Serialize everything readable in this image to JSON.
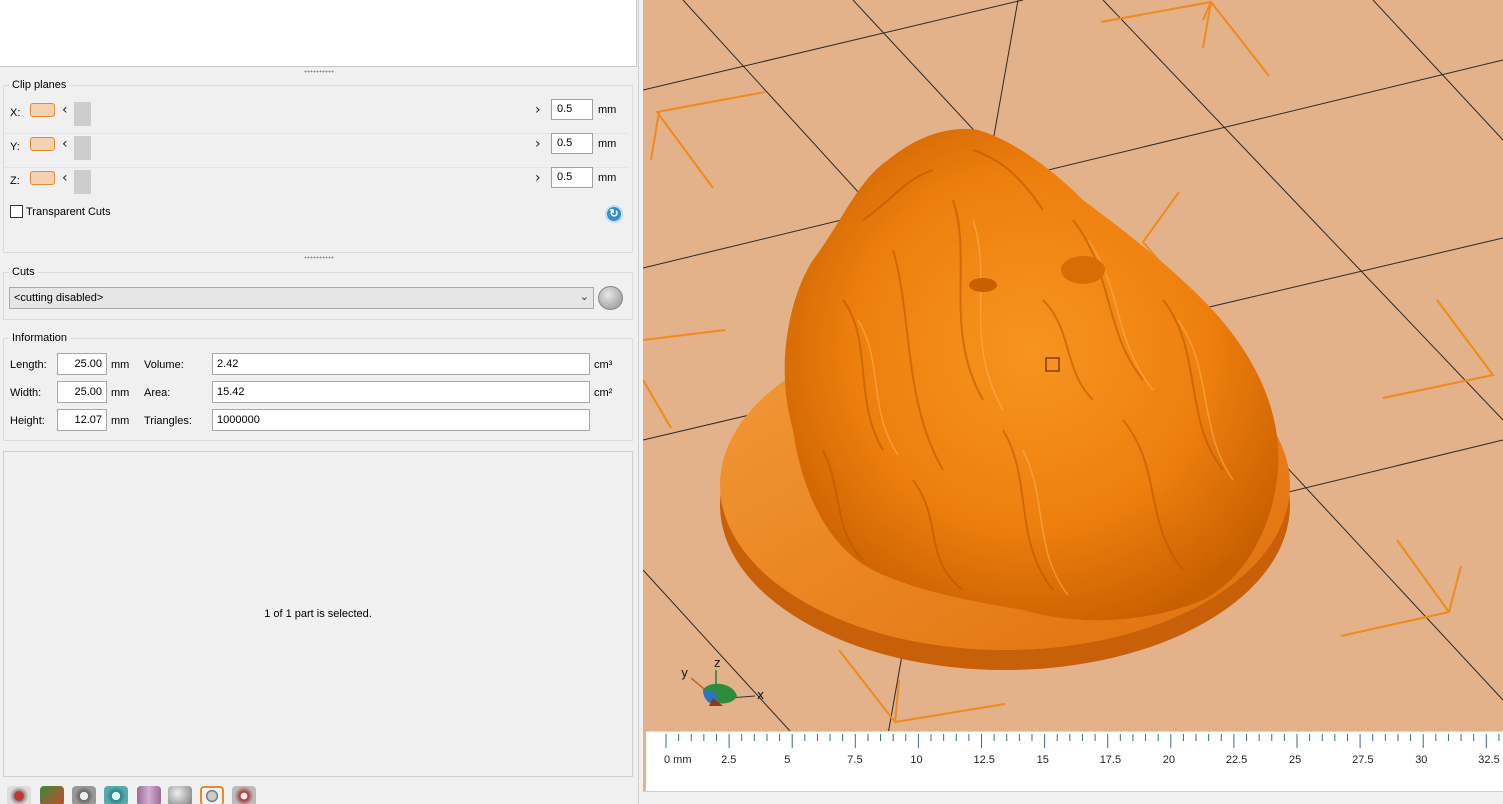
{
  "clip_planes": {
    "title": "Clip planes",
    "rows": [
      {
        "axis": "X:",
        "value": "0.5",
        "unit": "mm"
      },
      {
        "axis": "Y:",
        "value": "0.5",
        "unit": "mm"
      },
      {
        "axis": "Z:",
        "value": "0.5",
        "unit": "mm"
      }
    ],
    "transparent_cuts_label": "Transparent Cuts",
    "transparent_cuts_checked": false
  },
  "cuts": {
    "title": "Cuts",
    "selected": "<cutting disabled>"
  },
  "information": {
    "title": "Information",
    "length_label": "Length:",
    "length_value": "25.00",
    "width_label": "Width:",
    "width_value": "25.00",
    "height_label": "Height:",
    "height_value": "12.07",
    "dim_unit": "mm",
    "volume_label": "Volume:",
    "volume_value": "2.42",
    "volume_unit": "cm³",
    "area_label": "Area:",
    "area_value": "15.42",
    "area_unit": "cm²",
    "triangles_label": "Triangles:",
    "triangles_value": "1000000"
  },
  "status": {
    "selection_text": "1 of 1 part is selected."
  },
  "viewport": {
    "ruler_labels": [
      "0 mm",
      "2.5",
      "5",
      "7.5",
      "10",
      "12.5",
      "15",
      "17.5",
      "20",
      "22.5",
      "25",
      "27.5",
      "30",
      "32.5"
    ],
    "gizmo": {
      "x": "x",
      "y": "y",
      "z": "z"
    },
    "colors": {
      "bed": "#e3b18a",
      "model": "#f08a1c",
      "bracket": "#f08a1c",
      "grid": "#2a2a2a"
    }
  },
  "toolbar": {
    "icons": [
      "settings-gear-icon",
      "repair-icon",
      "rotate-icon",
      "refresh-icon",
      "box-view-icon",
      "sphere-icon",
      "selected-tool-icon",
      "saw-tool-icon"
    ]
  }
}
